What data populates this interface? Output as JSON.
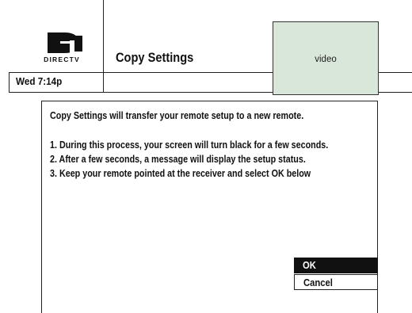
{
  "header": {
    "logo_text": "DIRECTV",
    "title": "Copy Settings",
    "clock": "Wed 7:14p"
  },
  "video": {
    "label": "video",
    "bg_color": "#d9e6da"
  },
  "dialog": {
    "intro": "Copy Settings will transfer your remote setup to a new remote.",
    "steps": [
      "1. During this process, your screen will turn black for a few seconds.",
      "2. After a few seconds, a message will display the setup status.",
      "3. Keep your remote pointed at the receiver and select OK below"
    ],
    "options": [
      {
        "label": "OK",
        "selected": true
      },
      {
        "label": "Cancel",
        "selected": false
      }
    ]
  },
  "colors": {
    "selected_bg": "#111111",
    "selected_text": "#ffffff",
    "frame": "#222222"
  }
}
